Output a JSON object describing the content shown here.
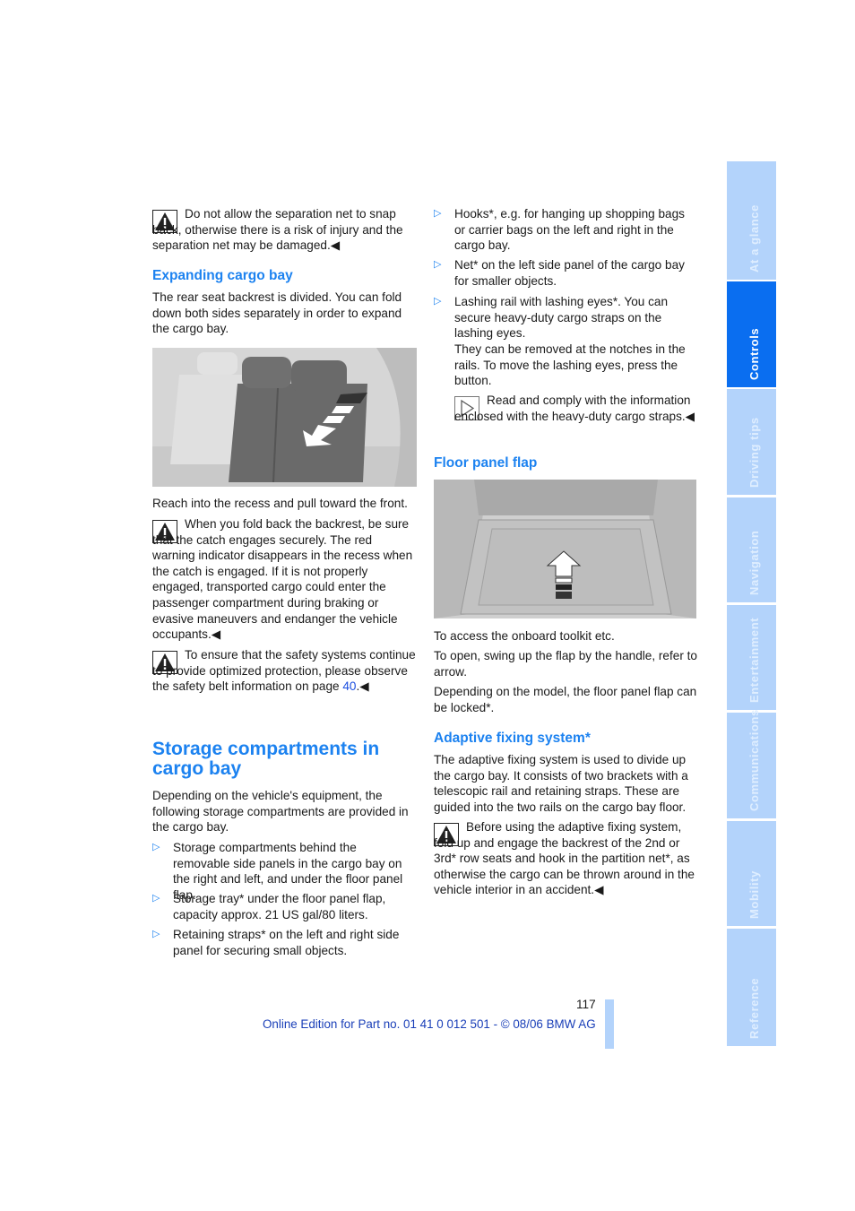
{
  "left": {
    "warn1": "Do not allow the separation net to snap back, otherwise there is a risk of injury and the separation net may be damaged.◀",
    "expanding": {
      "heading": "Expanding cargo bay",
      "body": "The rear seat backrest is divided. You can fold down both sides separately in order to expand the cargo bay.",
      "caption": "Reach into the recess and pull toward the front."
    },
    "warn2": "When you fold back the backrest, be sure that the catch engages securely. The red warning indicator disappears in the recess when the catch is engaged. If it is not properly engaged, transported cargo could enter the passenger compartment during braking or evasive maneuvers and endanger the vehicle occupants.◀",
    "warn3_prefix": "To ensure that the safety systems continue to provide optimized protection, please observe the safety belt information on page ",
    "warn3_link": "40",
    "warn3_suffix": ".◀",
    "storage": {
      "heading": "Storage compartments in cargo bay",
      "intro": "Depending on the vehicle's equipment, the following storage compartments are provided in the cargo bay.",
      "items": [
        "Storage compartments behind the removable side panels in the cargo bay on the right and left, and under the floor panel flap.",
        "Storage tray* under the floor panel flap, capacity approx. 21 US gal/80 liters.",
        "Retaining straps* on the left and right side panel for securing small objects."
      ]
    }
  },
  "right": {
    "items": [
      "Hooks*, e.g. for hanging up shopping bags or carrier bags on the left and right in the cargo bay.",
      "Net* on the left side panel of the cargo bay for smaller objects.",
      "Lashing rail with lashing eyes*. You can secure heavy-duty cargo straps on the lashing eyes."
    ],
    "lashing_extra": "They can be removed at the notches in the rails. To move the lashing eyes, press the button.",
    "note": "Read and comply with the information enclosed with the heavy-duty cargo straps.◀",
    "floor": {
      "heading": "Floor panel flap",
      "p1": "To access the onboard toolkit etc.",
      "p2": "To open, swing up the flap by the handle, refer to arrow.",
      "p3": "Depending on the model, the floor panel flap can be locked*."
    },
    "adaptive": {
      "heading": "Adaptive fixing system*",
      "body": "The adaptive fixing system is used to divide up the cargo bay. It consists of two brackets with a telescopic rail and retaining straps. These are guided into the two rails on the cargo bay floor.",
      "warn": "Before using the adaptive fixing system, fold up and engage the backrest of the 2nd or 3rd* row seats and hook in the partition net*, as otherwise the cargo can be thrown around in the vehicle interior in an accident.◀"
    }
  },
  "sidebar": {
    "tabs": [
      "At a glance",
      "Controls",
      "Driving tips",
      "Navigation",
      "Entertainment",
      "Communications",
      "Mobility",
      "Reference"
    ],
    "active": "Controls"
  },
  "footer": {
    "page_number": "117",
    "edition": "Online Edition for Part no. 01 41 0 012 501 - © 08/06 BMW AG"
  },
  "colors": {
    "accent": "#1c82f0",
    "tab_active": "#0a6ef0",
    "tab_inactive": "#b3d3fb"
  }
}
